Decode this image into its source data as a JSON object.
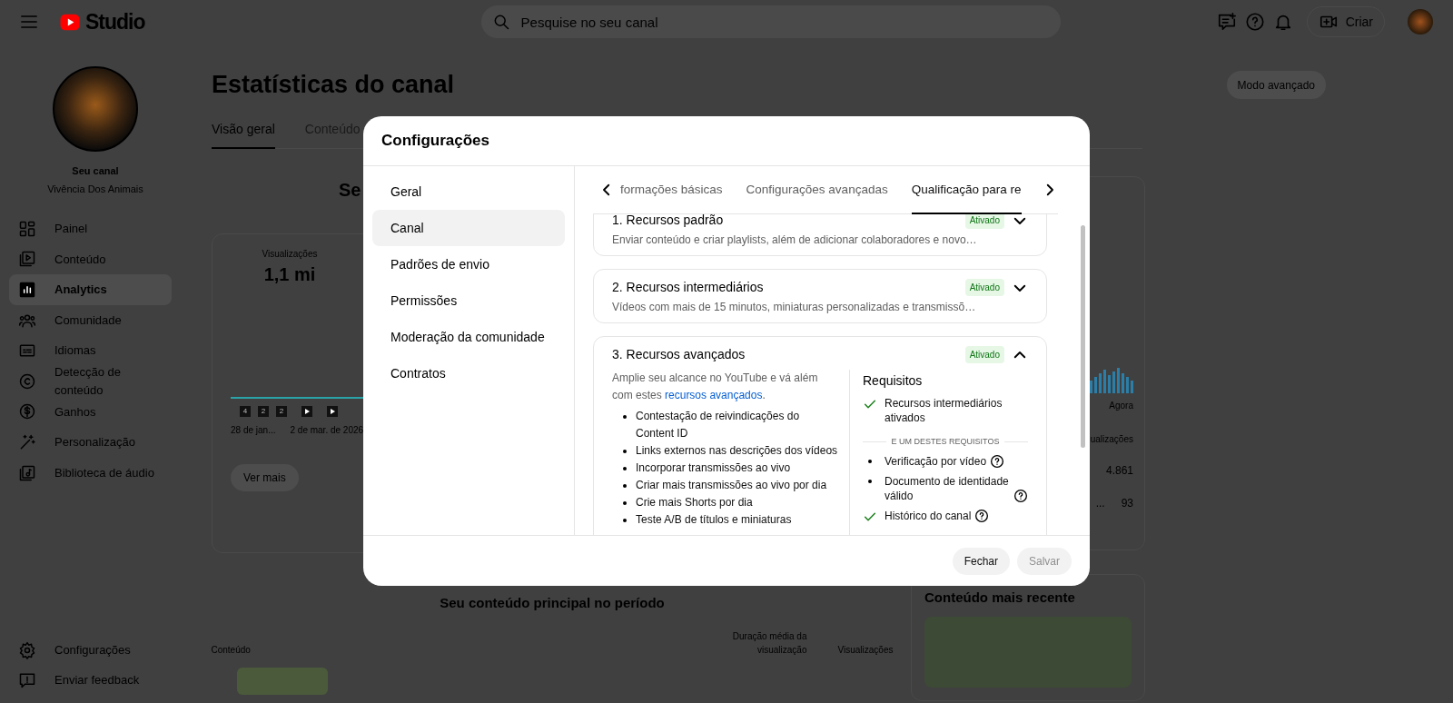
{
  "header": {
    "logo_text": "Studio",
    "search": {
      "placeholder": "Pesquise no seu canal"
    },
    "create_label": "Criar"
  },
  "channel": {
    "label": "Seu canal",
    "name": "Vivência Dos Animais"
  },
  "sidebar": {
    "items": [
      {
        "label": "Painel",
        "kind": "dashboard",
        "selected": false
      },
      {
        "label": "Conteúdo",
        "kind": "content",
        "selected": false
      },
      {
        "label": "Analytics",
        "kind": "analytics",
        "selected": true
      },
      {
        "label": "Comunidade",
        "kind": "community",
        "selected": false
      },
      {
        "label": "Idiomas",
        "kind": "subtitles",
        "selected": false
      },
      {
        "label": "Detecção de conteúdo",
        "kind": "copyright",
        "selected": false
      },
      {
        "label": "Ganhos",
        "kind": "dollar",
        "selected": false
      },
      {
        "label": "Personalização",
        "kind": "wand",
        "selected": false
      },
      {
        "label": "Biblioteca de áudio",
        "kind": "music",
        "selected": false
      }
    ],
    "footer_items": [
      {
        "label": "Configurações",
        "kind": "settings"
      },
      {
        "label": "Enviar feedback",
        "kind": "feedback"
      }
    ]
  },
  "page": {
    "title": "Estatísticas do canal",
    "advanced_mode": "Modo avançado",
    "tabs": [
      {
        "label": "Visão geral",
        "selected": true
      },
      {
        "label": "Conteúdo",
        "selected": false
      }
    ],
    "overview_heading": "Se",
    "metric": {
      "label": "Visualizações",
      "value": "1,1 mi"
    },
    "chart_badges": [
      {
        "kind": "number",
        "text": "4"
      },
      {
        "kind": "number",
        "text": "2"
      },
      {
        "kind": "number",
        "text": "2"
      },
      {
        "kind": "play"
      },
      {
        "kind": "play"
      }
    ],
    "chart_dates": [
      "28 de jan...",
      "2 de mar. de 2026"
    ],
    "more_button": "Ver mais",
    "side_card": {
      "axis_label": "Agora",
      "column_label": "ualizações",
      "rows": [
        {
          "value": "4.861"
        },
        {
          "label": "...",
          "value": "93"
        }
      ]
    },
    "top_content": {
      "title": "Seu conteúdo principal no período",
      "columns": [
        "Conteúdo",
        "Duração média da visualização",
        "Visualizações"
      ]
    },
    "latest": {
      "title": "Conteúdo mais recente"
    }
  },
  "dialog": {
    "title": "Configurações",
    "nav": [
      {
        "label": "Geral",
        "selected": false
      },
      {
        "label": "Canal",
        "selected": true
      },
      {
        "label": "Padrões de envio",
        "selected": false
      },
      {
        "label": "Permissões",
        "selected": false
      },
      {
        "label": "Moderação da comunidade",
        "selected": false
      },
      {
        "label": "Contratos",
        "selected": false
      }
    ],
    "tabs": [
      {
        "label": "formações básicas",
        "selected": false
      },
      {
        "label": "Configurações avançadas",
        "selected": false
      },
      {
        "label": "Qualificação para re",
        "selected": true
      }
    ],
    "sections": [
      {
        "title": "1. Recursos padrão",
        "description": "Enviar conteúdo e criar playlists, além de adicionar colaboradores e novo…",
        "status": "Ativado",
        "expanded": false
      },
      {
        "title": "2. Recursos intermediários",
        "description": "Vídeos com mais de 15 minutos, miniaturas personalizadas e transmissõ…",
        "status": "Ativado",
        "expanded": false
      },
      {
        "title": "3. Recursos avançados",
        "status": "Ativado",
        "expanded": true,
        "intro": "Amplie seu alcance no YouTube e vá além com estes",
        "intro_link": "recursos avançados",
        "intro_end": ".",
        "features": [
          "Contestação de reivindicações do Content ID",
          "Links externos nas descrições dos vídeos",
          "Incorporar transmissões ao vivo",
          "Criar mais transmissões ao vivo por dia",
          "Crie mais Shorts por dia",
          "Teste A/B de títulos e miniaturas"
        ],
        "requirements": {
          "title": "Requisitos",
          "items": [
            {
              "text": "Recursos intermediários ativados",
              "kind": "met",
              "help": false
            }
          ],
          "divider": "E UM DESTES REQUISITOS",
          "options": [
            {
              "text": "Verificação por vídeo",
              "kind": "bullet",
              "help": true
            },
            {
              "text": "Documento de identidade válido",
              "kind": "bullet",
              "help": true
            },
            {
              "text": "Histórico do canal",
              "kind": "met",
              "help": true
            }
          ]
        }
      }
    ],
    "buttons": [
      {
        "label": "Fechar",
        "disabled": false
      },
      {
        "label": "Salvar",
        "disabled": true
      }
    ]
  }
}
